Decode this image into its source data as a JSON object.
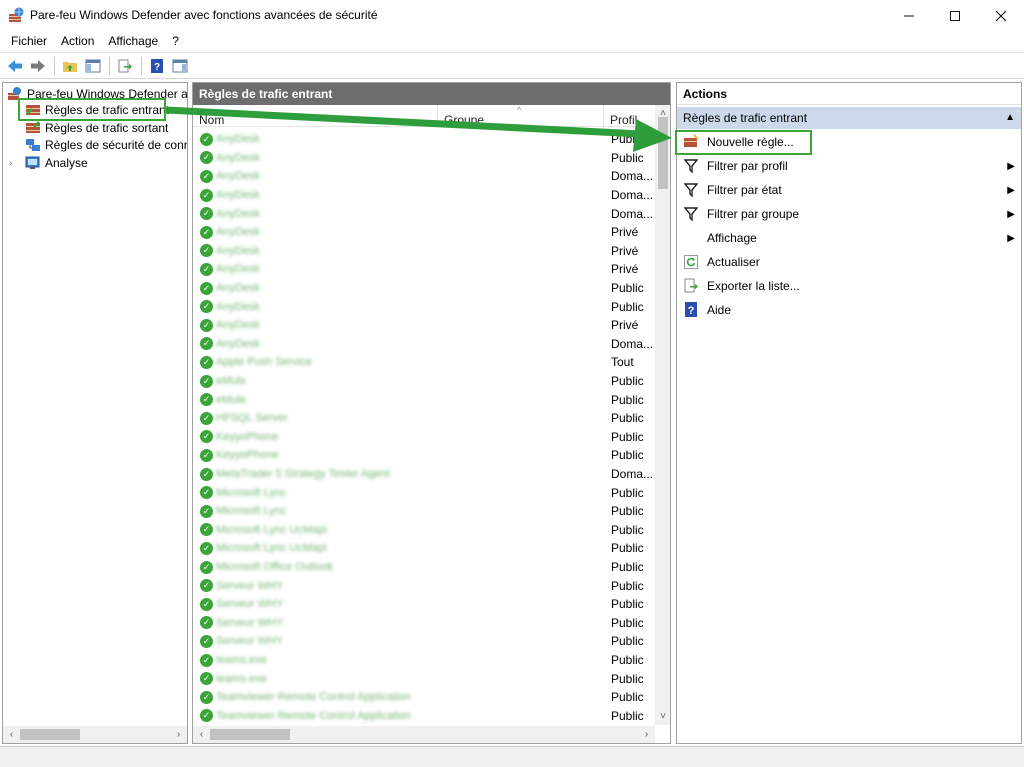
{
  "window": {
    "title": "Pare-feu Windows Defender avec fonctions avancées de sécurité",
    "minimize": "—",
    "maximize": "☐",
    "close": "✕"
  },
  "menu": [
    "Fichier",
    "Action",
    "Affichage",
    "?"
  ],
  "tree": {
    "root": "Pare-feu Windows Defender av",
    "items": [
      "Règles de trafic entrant",
      "Règles de trafic sortant",
      "Règles de sécurité de conne",
      "Analyse"
    ]
  },
  "middle": {
    "header": "Règles de trafic entrant",
    "columns": [
      "Nom",
      "Groupe",
      "Profil"
    ],
    "rows": [
      {
        "name": "AnyDesk",
        "profile": "Public"
      },
      {
        "name": "AnyDesk",
        "profile": "Public"
      },
      {
        "name": "AnyDesk",
        "profile": "Doma..."
      },
      {
        "name": "AnyDesk",
        "profile": "Doma..."
      },
      {
        "name": "AnyDesk",
        "profile": "Doma..."
      },
      {
        "name": "AnyDesk",
        "profile": "Privé"
      },
      {
        "name": "AnyDesk",
        "profile": "Privé"
      },
      {
        "name": "AnyDesk",
        "profile": "Privé"
      },
      {
        "name": "AnyDesk",
        "profile": "Public"
      },
      {
        "name": "AnyDesk",
        "profile": "Public"
      },
      {
        "name": "AnyDesk",
        "profile": "Privé"
      },
      {
        "name": "AnyDesk",
        "profile": "Doma..."
      },
      {
        "name": "Apple Push Service",
        "profile": "Tout"
      },
      {
        "name": "eMule",
        "profile": "Public"
      },
      {
        "name": "eMule",
        "profile": "Public"
      },
      {
        "name": "HFSQL Server",
        "profile": "Public"
      },
      {
        "name": "KeyyoPhone",
        "profile": "Public"
      },
      {
        "name": "KeyyoPhone",
        "profile": "Public"
      },
      {
        "name": "MetaTrader 5 Strategy Tester Agent",
        "profile": "Doma..."
      },
      {
        "name": "Microsoft Lync",
        "profile": "Public"
      },
      {
        "name": "Microsoft Lync",
        "profile": "Public"
      },
      {
        "name": "Microsoft Lync UcMapi",
        "profile": "Public"
      },
      {
        "name": "Microsoft Lync UcMapi",
        "profile": "Public"
      },
      {
        "name": "Microsoft Office Outlook",
        "profile": "Public"
      },
      {
        "name": "Serveur WHY",
        "profile": "Public"
      },
      {
        "name": "Serveur WHY",
        "profile": "Public"
      },
      {
        "name": "Serveur WHY",
        "profile": "Public"
      },
      {
        "name": "Serveur WHY",
        "profile": "Public"
      },
      {
        "name": "teams.exe",
        "profile": "Public"
      },
      {
        "name": "teams.exe",
        "profile": "Public"
      },
      {
        "name": "Teamviewer Remote Control Application",
        "profile": "Public"
      },
      {
        "name": "Teamviewer Remote Control Application",
        "profile": "Public"
      }
    ]
  },
  "actions": {
    "header": "Actions",
    "section": "Règles de trafic entrant",
    "items": [
      {
        "label": "Nouvelle règle...",
        "icon": "new-rule-icon",
        "submenu": false
      },
      {
        "label": "Filtrer par profil",
        "icon": "filter-icon",
        "submenu": true
      },
      {
        "label": "Filtrer par état",
        "icon": "filter-icon",
        "submenu": true
      },
      {
        "label": "Filtrer par groupe",
        "icon": "filter-icon",
        "submenu": true
      },
      {
        "label": "Affichage",
        "icon": "",
        "submenu": true
      },
      {
        "label": "Actualiser",
        "icon": "refresh-icon",
        "submenu": false
      },
      {
        "label": "Exporter la liste...",
        "icon": "export-icon",
        "submenu": false
      },
      {
        "label": "Aide",
        "icon": "help-icon",
        "submenu": false
      }
    ]
  },
  "colors": {
    "highlight_border": "#3aa63a",
    "annotation_arrow": "#2e9e3c",
    "pane_header_bg": "#6d6d6d",
    "section_bg": "#cdd9ea",
    "check_green": "#3aa63a"
  }
}
